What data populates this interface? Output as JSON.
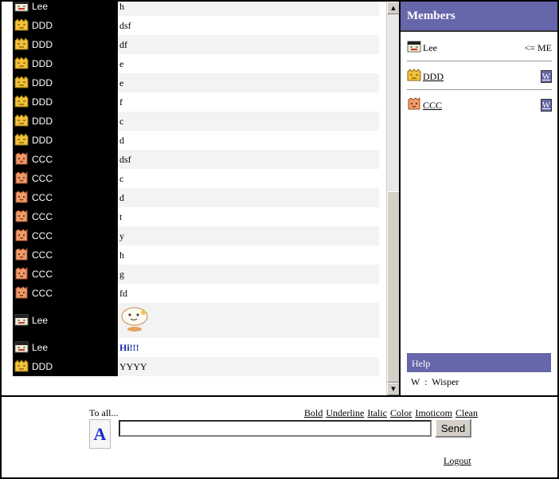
{
  "chat": {
    "rows": [
      {
        "nick": "Lee",
        "icon": "lee-face-icon",
        "msg": "h"
      },
      {
        "nick": "DDD",
        "icon": "ddd-face-icon",
        "msg": "dsf"
      },
      {
        "nick": "DDD",
        "icon": "ddd-face-icon",
        "msg": "df"
      },
      {
        "nick": "DDD",
        "icon": "ddd-face-icon",
        "msg": "e"
      },
      {
        "nick": "DDD",
        "icon": "ddd-face-icon",
        "msg": "e"
      },
      {
        "nick": "DDD",
        "icon": "ddd-face-icon",
        "msg": "f"
      },
      {
        "nick": "DDD",
        "icon": "ddd-face-icon",
        "msg": "c"
      },
      {
        "nick": "DDD",
        "icon": "ddd-face-icon",
        "msg": "d"
      },
      {
        "nick": "CCC",
        "icon": "ccc-face-icon",
        "msg": "dsf"
      },
      {
        "nick": "CCC",
        "icon": "ccc-face-icon",
        "msg": "c"
      },
      {
        "nick": "CCC",
        "icon": "ccc-face-icon",
        "msg": "d"
      },
      {
        "nick": "CCC",
        "icon": "ccc-face-icon",
        "msg": "t"
      },
      {
        "nick": "CCC",
        "icon": "ccc-face-icon",
        "msg": "y"
      },
      {
        "nick": "CCC",
        "icon": "ccc-face-icon",
        "msg": "h"
      },
      {
        "nick": "CCC",
        "icon": "ccc-face-icon",
        "msg": "g"
      },
      {
        "nick": "CCC",
        "icon": "ccc-face-icon",
        "msg": "fd"
      },
      {
        "nick": "Lee",
        "icon": "lee-face-icon",
        "msg": "",
        "emoticon": "thinking-emoticon-icon"
      },
      {
        "nick": "Lee",
        "icon": "lee-face-icon",
        "msg": "Hi!!!",
        "style": "bold-blue"
      },
      {
        "nick": "DDD",
        "icon": "ddd-face-icon",
        "msg": "YYYY"
      }
    ]
  },
  "members": {
    "title": "Members",
    "list": [
      {
        "name": "Lee",
        "icon": "lee-face-icon",
        "tag": "<= ME"
      },
      {
        "name": "DDD",
        "icon": "ddd-face-icon",
        "whisper": "W"
      },
      {
        "name": "CCC",
        "icon": "ccc-face-icon",
        "whisper": "W"
      }
    ],
    "help_title": "Help",
    "help_text": "W  :  Wisper"
  },
  "input": {
    "to_label": "To all...",
    "font_icon_label": "A",
    "toolbar": [
      "Bold",
      "Underline",
      "Italic",
      "Color",
      "Imoticom",
      "Clean"
    ],
    "message_value": "",
    "send_label": "Send",
    "logout_label": "Logout"
  },
  "colors": {
    "panel_header": "#6666aa",
    "nick_bg": "#000000",
    "highlight_text": "#1a2aa0"
  }
}
